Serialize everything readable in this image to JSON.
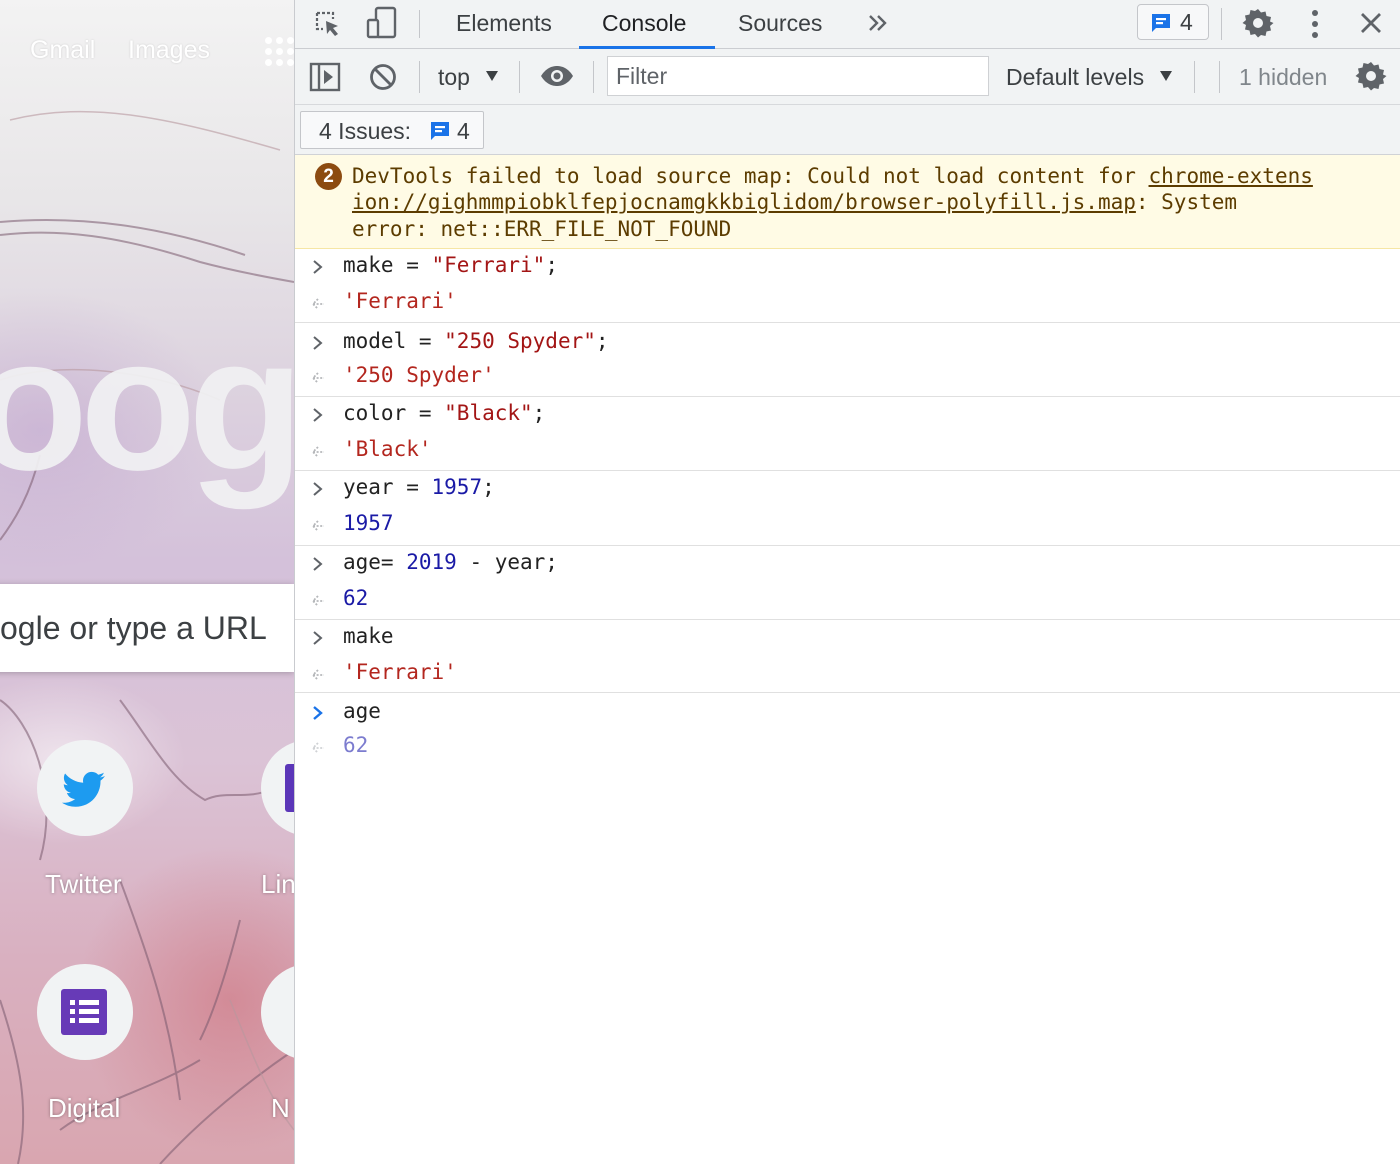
{
  "page": {
    "top_links": [
      "Gmail",
      "Images"
    ],
    "logo_text": "oogle",
    "search_placeholder": "ogle or type a URL",
    "shortcuts": [
      {
        "label": "Twitter",
        "icon": "twitter-icon"
      },
      {
        "label": "Lin",
        "icon": "linkedin-icon"
      },
      {
        "label": "Digital",
        "icon": "forms-icon"
      },
      {
        "label": "N",
        "icon": "shortcut-icon"
      }
    ]
  },
  "devtools": {
    "tabs": [
      "Elements",
      "Console",
      "Sources"
    ],
    "active_tab": "Console",
    "issues_count": "4",
    "toolbar": {
      "context": "top",
      "filter_placeholder": "Filter",
      "levels": "Default levels",
      "hidden": "1 hidden"
    },
    "issues_bar": {
      "label": "4 Issues:",
      "count": "4"
    },
    "warning": {
      "count": "2",
      "line1_text": "DevTools failed to load source map: Could not load content for ",
      "line1_link": "chrome-extens",
      "line2_link": "ion://gighmmpiobklfepjocnamgkkbiglidom/browser-polyfill.js.map",
      "line2_text": ": System",
      "line3_text": "error: net::ERR_FILE_NOT_FOUND"
    },
    "entries": [
      {
        "input": [
          "make = ",
          "\"Ferrari\"",
          ";"
        ],
        "output": "'Ferrari'"
      },
      {
        "input": [
          "model = ",
          "\"250 Spyder\"",
          ";"
        ],
        "output": "'250 Spyder'"
      },
      {
        "input": [
          "color = ",
          "\"Black\"",
          ";"
        ],
        "output": "'Black'"
      },
      {
        "input": [
          "year = ",
          "1957",
          ";"
        ],
        "output": "1957"
      },
      {
        "input": [
          "age= ",
          "2019",
          " - year;"
        ],
        "output": "62"
      },
      {
        "input": [
          "make",
          "",
          ""
        ],
        "output": "'Ferrari'"
      },
      {
        "input": [
          "age",
          "",
          ""
        ],
        "output": "62"
      }
    ]
  },
  "colors": {
    "accent": "#1a73e8",
    "string": "#a31515",
    "number": "#1a1aa6",
    "warning_bg": "#fffbe5",
    "warning_text": "#5c3c00"
  }
}
